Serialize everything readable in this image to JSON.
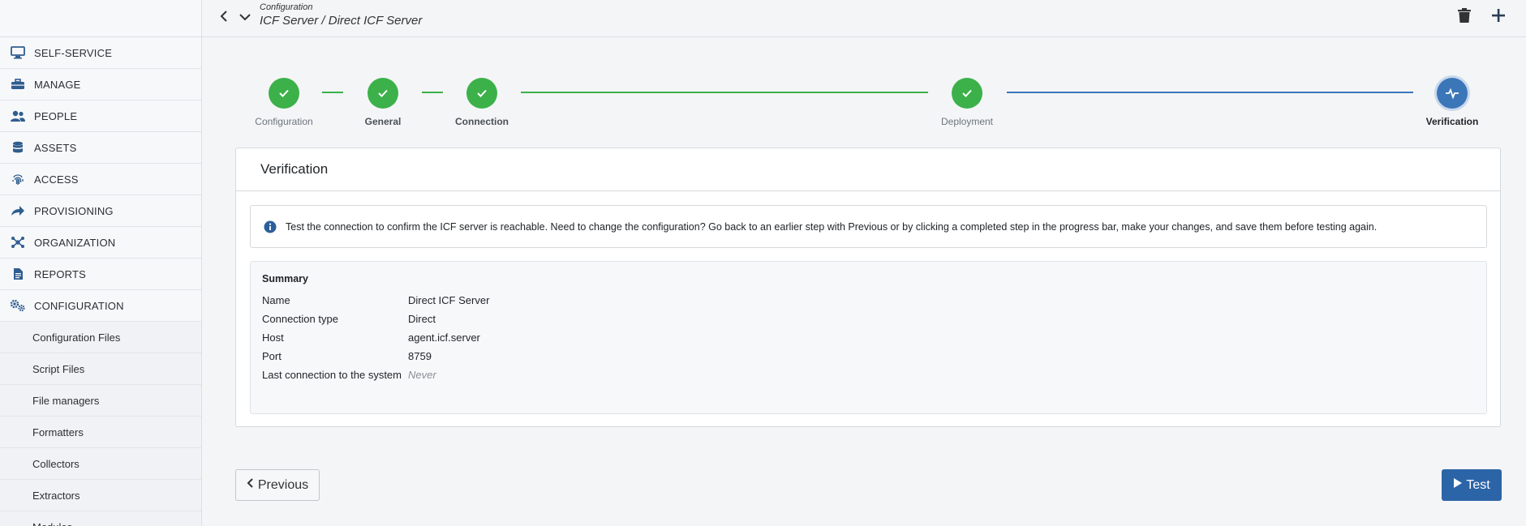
{
  "header": {
    "breadcrumb_parent": "Configuration",
    "breadcrumb_title": "ICF Server / Direct ICF Server",
    "back_icon": "chevron-left-icon",
    "dropdown_icon": "chevron-down-icon",
    "delete_icon": "trash-icon",
    "add_icon": "plus-icon"
  },
  "sidebar": {
    "items": [
      {
        "label": "SELF-SERVICE",
        "icon": "monitor-icon"
      },
      {
        "label": "MANAGE",
        "icon": "toolbox-icon"
      },
      {
        "label": "PEOPLE",
        "icon": "people-icon"
      },
      {
        "label": "ASSETS",
        "icon": "database-icon"
      },
      {
        "label": "ACCESS",
        "icon": "fingerprint-icon"
      },
      {
        "label": "PROVISIONING",
        "icon": "share-icon"
      },
      {
        "label": "ORGANIZATION",
        "icon": "network-icon"
      },
      {
        "label": "REPORTS",
        "icon": "document-icon"
      },
      {
        "label": "CONFIGURATION",
        "icon": "gears-icon"
      }
    ],
    "subitems": [
      "Configuration Files",
      "Script Files",
      "File managers",
      "Formatters",
      "Collectors",
      "Extractors",
      "Modules"
    ]
  },
  "stepper": {
    "steps": [
      {
        "label": "Configuration",
        "state": "done"
      },
      {
        "label": "General",
        "state": "done"
      },
      {
        "label": "Connection",
        "state": "done"
      },
      {
        "label": "Deployment",
        "state": "done"
      },
      {
        "label": "Verification",
        "state": "current"
      }
    ]
  },
  "card": {
    "title": "Verification",
    "info_text": "Test the connection to confirm the ICF server is reachable. Need to change the configuration? Go back to an earlier step with Previous or by clicking a completed step in the progress bar, make your changes, and save them before testing again.",
    "summary": {
      "title": "Summary",
      "rows": [
        {
          "key": "Name",
          "value": "Direct ICF Server"
        },
        {
          "key": "Connection type",
          "value": "Direct"
        },
        {
          "key": "Host",
          "value": "agent.icf.server"
        },
        {
          "key": "Port",
          "value": "8759"
        },
        {
          "key": "Last connection to the system",
          "value": "Never"
        }
      ]
    }
  },
  "footer": {
    "previous_label": "Previous",
    "test_label": "Test"
  },
  "colors": {
    "done": "#3cb14a",
    "current": "#3b76b8",
    "primary_button": "#2c64a8",
    "icon_blue": "#2f5d8f"
  }
}
